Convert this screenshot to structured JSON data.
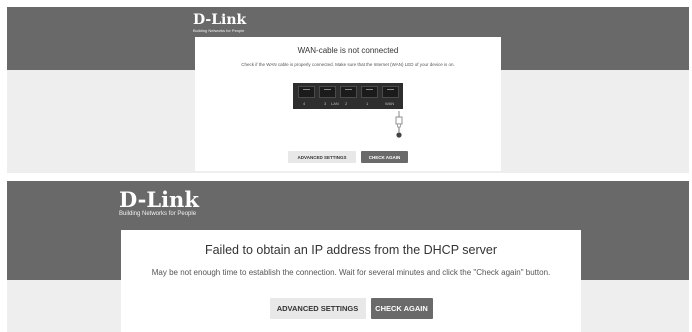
{
  "colors": {
    "header": "#696969",
    "panel_bg": "#eeeeee",
    "card_bg": "#ffffff",
    "primary_button": "#6a6a6a",
    "secondary_button": "#e8e8e8"
  },
  "screen1": {
    "logo": {
      "name": "D-Link",
      "tagline": "Building Networks for People"
    },
    "title": "WAN-cable is not connected",
    "description": "Check if the WAN cable is properly connected. Make sure that the Internet (WAN) LED of your device is on.",
    "ports": [
      "4",
      "3",
      "LAN",
      "2",
      "1",
      "WAN"
    ],
    "advanced_button": "ADVANCED SETTINGS",
    "check_button": "CHECK AGAIN"
  },
  "screen2": {
    "logo": {
      "name": "D-Link",
      "tagline": "Building Networks for People"
    },
    "title": "Failed to obtain an IP address from the DHCP server",
    "description": "May be not enough time to establish the connection. Wait for several minutes and click the \"Check again\" button.",
    "advanced_button": "ADVANCED SETTINGS",
    "check_button": "CHECK AGAIN"
  }
}
